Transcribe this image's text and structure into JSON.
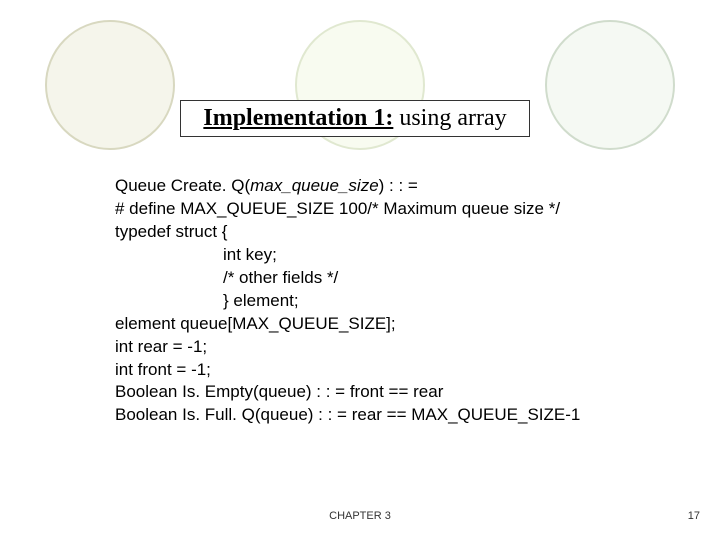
{
  "title": {
    "bold": "Implementation 1:",
    "rest": " using array"
  },
  "code": {
    "l1a": "Queue Create. Q(",
    "l1b": "max_queue_size",
    "l1c": ") : : =",
    "l2": "# define MAX_QUEUE_SIZE 100/* Maximum queue size */",
    "l3": "typedef struct {",
    "l4": "int key;",
    "l5": "/* other fields */",
    "l6": "} element;",
    "l7": "element queue[MAX_QUEUE_SIZE];",
    "l8": "int rear = -1;",
    "l9": "int front = -1;",
    "l10": "Boolean Is. Empty(queue) : : = front == rear",
    "l11": "Boolean Is. Full. Q(queue) : : = rear == MAX_QUEUE_SIZE-1"
  },
  "footer": {
    "chapter": "CHAPTER 3",
    "page": "17"
  }
}
